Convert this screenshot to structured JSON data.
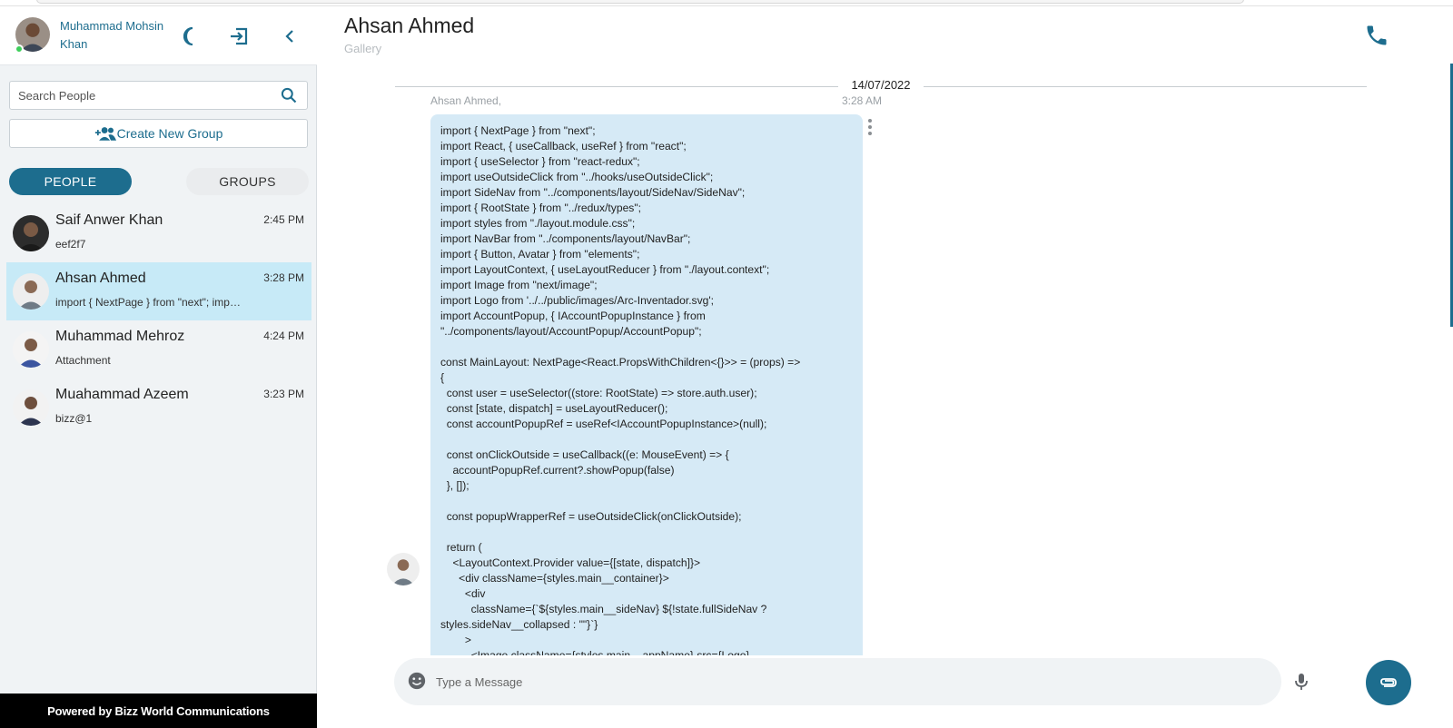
{
  "colors": {
    "accent": "#1d6d8e",
    "active_row": "#c7eaf7",
    "bubble": "#d6eaf6",
    "online": "#3ecf5b"
  },
  "user": {
    "name": "Muhammad Mohsin Khan",
    "status": "online"
  },
  "header_icons": [
    "moon-icon",
    "logout-icon",
    "chevron-left-icon"
  ],
  "search": {
    "placeholder": "Search People",
    "value": ""
  },
  "create_group": {
    "label": "Create New Group",
    "icon": "group-add-icon"
  },
  "tabs": [
    {
      "label": "PEOPLE",
      "active": true
    },
    {
      "label": "GROUPS",
      "active": false
    }
  ],
  "contacts": [
    {
      "name": "Saif Anwer Khan",
      "preview": "eef2f7",
      "time": "2:45 PM",
      "active": false
    },
    {
      "name": "Ahsan Ahmed",
      "preview": "import { NextPage } from \"next\"; import React, { useCallback, useRef } from \"react\";",
      "time": "3:28 PM",
      "active": true
    },
    {
      "name": "Muhammad Mehroz",
      "preview": "Attachment",
      "time": "4:24 PM",
      "active": false
    },
    {
      "name": "Muahammad Azeem",
      "preview": "bizz@1",
      "time": "3:23 PM",
      "active": false
    }
  ],
  "footer": {
    "powered_by": "Powered by Bizz World Communications"
  },
  "chat": {
    "title": "Ahsan Ahmed",
    "subtitle": "Gallery",
    "call_icon": "phone-icon",
    "date_divider": "14/07/2022",
    "message": {
      "sender": "Ahsan Ahmed,",
      "time": "3:28 AM",
      "text": "import { NextPage } from \"next\";\nimport React, { useCallback, useRef } from \"react\";\nimport { useSelector } from \"react-redux\";\nimport useOutsideClick from \"../hooks/useOutsideClick\";\nimport SideNav from \"../components/layout/SideNav/SideNav\";\nimport { RootState } from \"../redux/types\";\nimport styles from \"./layout.module.css\";\nimport NavBar from \"../components/layout/NavBar\";\nimport { Button, Avatar } from \"elements\";\nimport LayoutContext, { useLayoutReducer } from \"./layout.context\";\nimport Image from \"next/image\";\nimport Logo from '../../public/images/Arc-Inventador.svg';\nimport AccountPopup, { IAccountPopupInstance } from \"../components/layout/AccountPopup/AccountPopup\";\n\nconst MainLayout: NextPage<React.PropsWithChildren<{}>> = (props) =>\n{\n  const user = useSelector((store: RootState) => store.auth.user);\n  const [state, dispatch] = useLayoutReducer();\n  const accountPopupRef = useRef<IAccountPopupInstance>(null);\n\n  const onClickOutside = useCallback((e: MouseEvent) => {\n    accountPopupRef.current?.showPopup(false)\n  }, []);\n\n  const popupWrapperRef = useOutsideClick(onClickOutside);\n\n  return (\n    <LayoutContext.Provider value={[state, dispatch]}>\n      <div className={styles.main__container}>\n        <div\n          className={`${styles.main__sideNav} ${!state.fullSideNav ? styles.sideNav__collapsed : \"\"}`}\n        >\n          <Image className={styles.main__appName} src={Logo}"
    }
  },
  "composer": {
    "placeholder": "Type a Message",
    "value": "",
    "icons": [
      "emoji-icon",
      "mic-icon",
      "attachment-icon"
    ]
  }
}
